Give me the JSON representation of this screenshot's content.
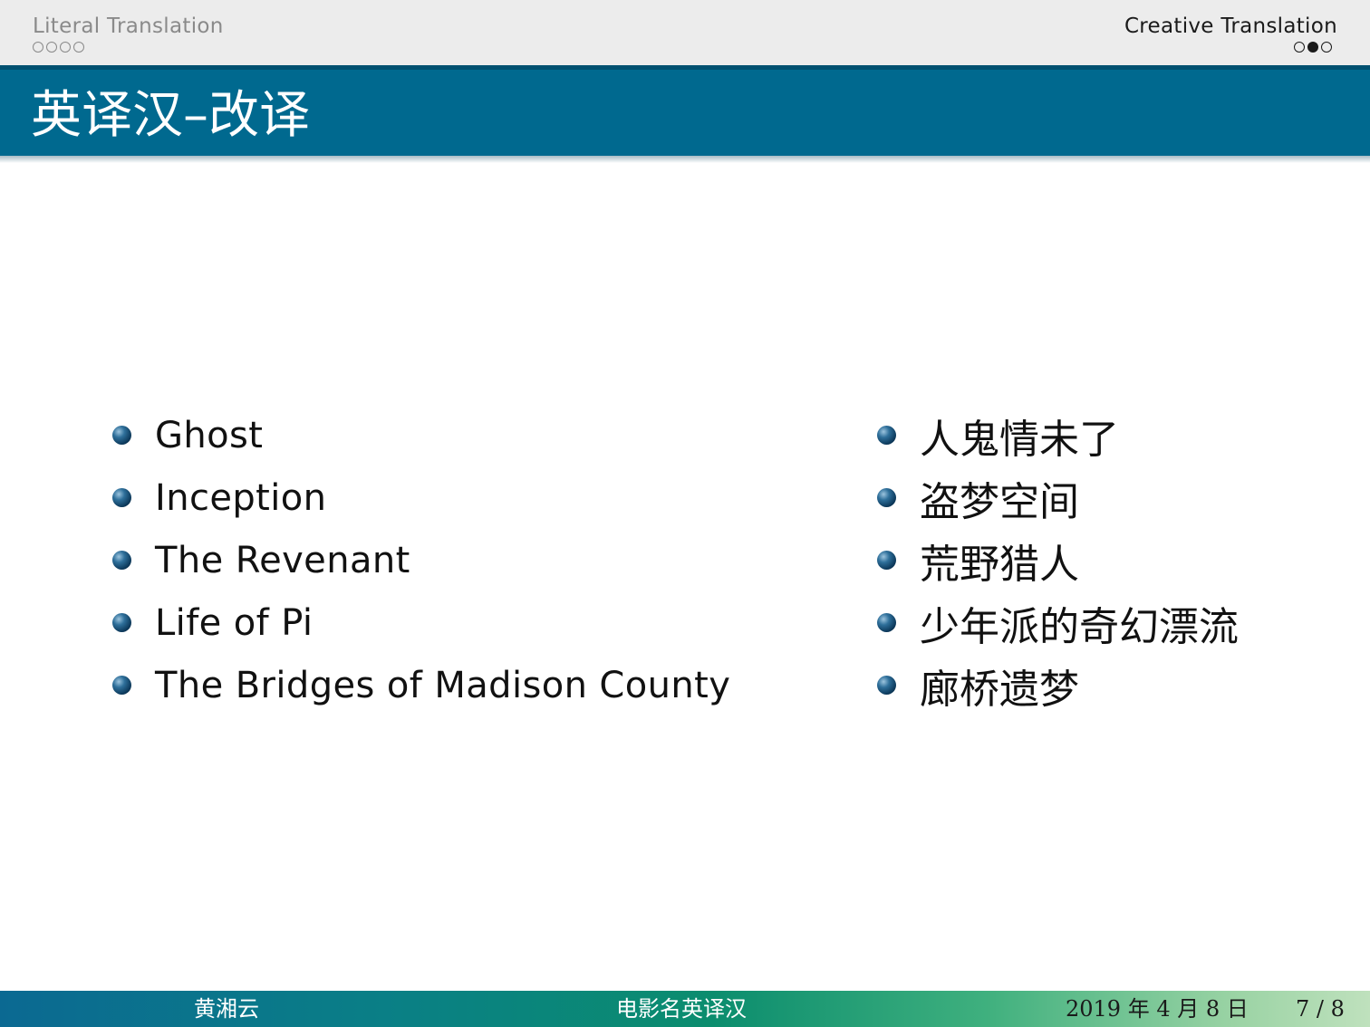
{
  "nav": {
    "left_section": "Literal Translation",
    "left_dots": [
      false,
      false,
      false,
      false
    ],
    "right_section": "Creative Translation",
    "right_dots": [
      false,
      true,
      false
    ]
  },
  "frame": {
    "title": "英译汉–改译"
  },
  "english_titles": [
    "Ghost",
    "Inception",
    "The Revenant",
    "Life of Pi",
    "The Bridges of Madison County"
  ],
  "chinese_titles": [
    "人鬼情未了",
    "盗梦空间",
    "荒野猎人",
    "少年派的奇幻漂流",
    "廊桥遗梦"
  ],
  "footer": {
    "author": "黄湘云",
    "short_title": "电影名英译汉",
    "date": "2019 年 4 月 8 日",
    "page": "7 / 8"
  },
  "colors": {
    "title_bar": "#00698f",
    "nav_bg": "#ececec"
  }
}
